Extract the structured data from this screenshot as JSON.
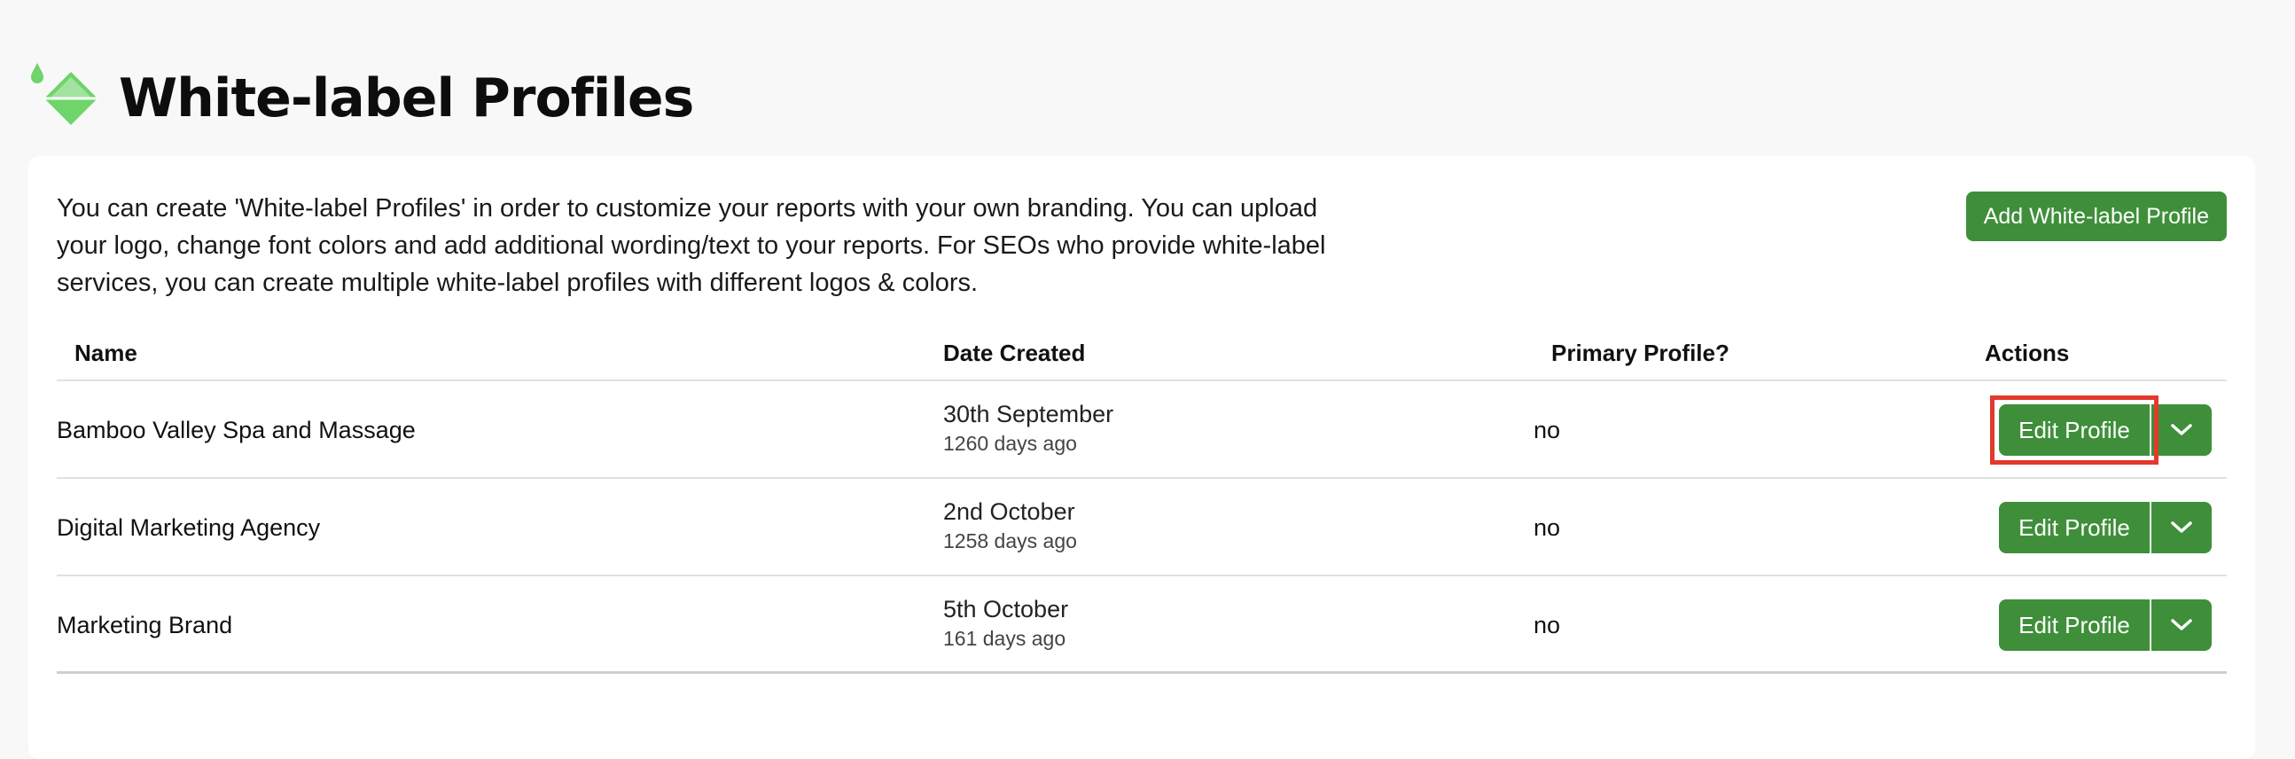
{
  "header": {
    "title": "White-label Profiles",
    "icon": "paint-bucket-icon",
    "accent_color": "#6fd46a"
  },
  "intro": {
    "text": "You can create 'White-label Profiles' in order to customize your reports with your own branding. You can upload your logo, change font colors and add additional wording/text to your reports. For SEOs who provide white-label services, you can create multiple white-label profiles with different logos & colors."
  },
  "add_button": {
    "label": "Add White-label Profile"
  },
  "table": {
    "columns": {
      "name": "Name",
      "date": "Date Created",
      "primary": "Primary Profile?",
      "actions": "Actions"
    },
    "rows": [
      {
        "name": "Bamboo Valley Spa and Massage",
        "date": "30th September",
        "ago": "1260 days ago",
        "primary": "no",
        "edit_label": "Edit Profile",
        "highlighted": true
      },
      {
        "name": "Digital Marketing Agency",
        "date": "2nd October",
        "ago": "1258 days ago",
        "primary": "no",
        "edit_label": "Edit Profile",
        "highlighted": false
      },
      {
        "name": "Marketing Brand",
        "date": "5th October",
        "ago": "161 days ago",
        "primary": "no",
        "edit_label": "Edit Profile",
        "highlighted": false
      }
    ]
  },
  "colors": {
    "button_green": "#3f8f3a",
    "highlight_red": "#e2392d"
  }
}
